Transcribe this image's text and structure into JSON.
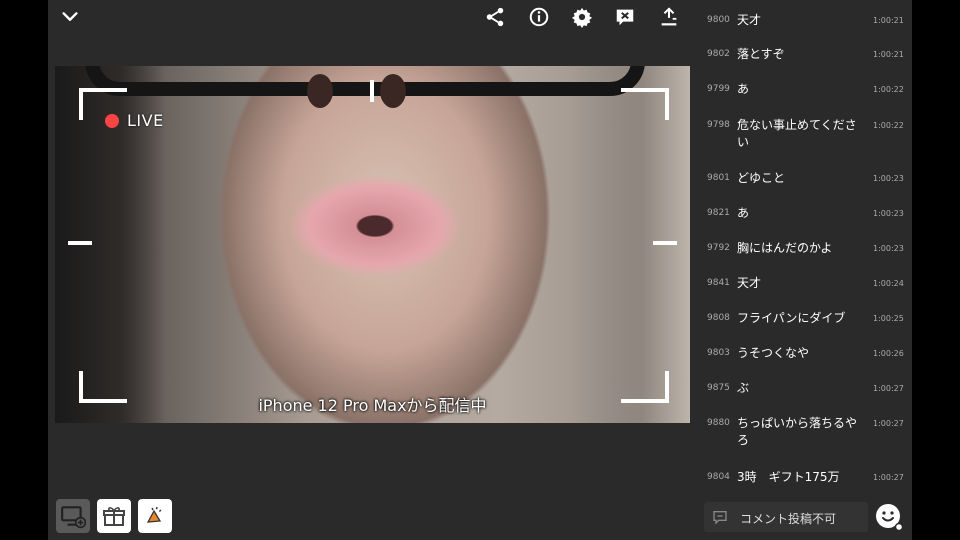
{
  "video": {
    "live_label": "LIVE",
    "caption": "iPhone 12 Pro Maxから配信中"
  },
  "toolbar": {
    "icons": [
      "chevron-down-icon",
      "share-icon",
      "info-icon",
      "gear-icon",
      "close-comments-icon",
      "download-icon"
    ]
  },
  "bottom_buttons": [
    "screen-add-icon",
    "gift-icon",
    "megaphone-icon"
  ],
  "comments": [
    {
      "id": "9800",
      "text": "天才",
      "time": "1:00:21"
    },
    {
      "id": "9802",
      "text": "落とすぞ",
      "time": "1:00:21"
    },
    {
      "id": "9799",
      "text": "あ",
      "time": "1:00:22"
    },
    {
      "id": "9798",
      "text": "危ない事止めてください",
      "time": "1:00:22"
    },
    {
      "id": "9801",
      "text": "どゆこと",
      "time": "1:00:23"
    },
    {
      "id": "9821",
      "text": "あ",
      "time": "1:00:23"
    },
    {
      "id": "9792",
      "text": "胸にはんだのかよ",
      "time": "1:00:23"
    },
    {
      "id": "9841",
      "text": "天才",
      "time": "1:00:24"
    },
    {
      "id": "9808",
      "text": "フライパンにダイブ",
      "time": "1:00:25"
    },
    {
      "id": "9803",
      "text": "うそつくなや",
      "time": "1:00:26"
    },
    {
      "id": "9875",
      "text": "ぶ",
      "time": "1:00:27"
    },
    {
      "id": "9880",
      "text": "ちっぱいから落ちるやろ",
      "time": "1:00:27"
    },
    {
      "id": "9804",
      "text": "3時　ギフト175万",
      "time": "1:00:27"
    }
  ],
  "comment_input": {
    "label": "コメント投稿不可"
  },
  "colors": {
    "background": "#2a2a2a",
    "live_dot": "#ff4444",
    "gift_button": "#ffffff",
    "screen_button": "#5a5a5a"
  }
}
